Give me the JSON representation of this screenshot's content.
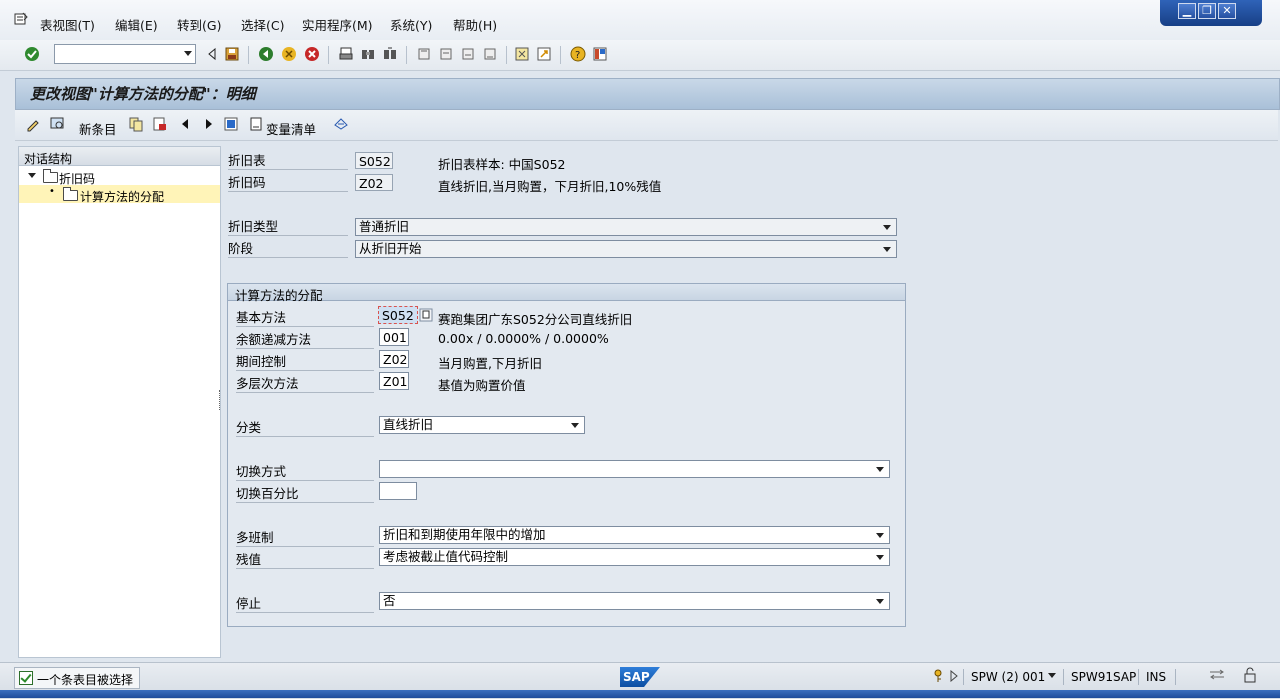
{
  "menu": {
    "items": [
      "表视图(T)",
      "编辑(E)",
      "转到(G)",
      "选择(C)",
      "实用程序(M)",
      "系统(Y)",
      "帮助(H)"
    ]
  },
  "window_controls": {
    "minimize": "▁",
    "restore": "❐",
    "close": "✕"
  },
  "screen_title": "更改视图\"计算方法的分配\"：明细",
  "app_toolbar": {
    "new_entries": "新条目",
    "change_list": "变量清单"
  },
  "tree": {
    "header": "对话结构",
    "items": [
      {
        "label": "折旧码"
      },
      {
        "label": "计算方法的分配"
      }
    ]
  },
  "header_fields": {
    "dep_chart": {
      "label": "折旧表",
      "value": "S052",
      "desc": "折旧表样本: 中国S052"
    },
    "dep_key": {
      "label": "折旧码",
      "value": "Z02",
      "desc": "直线折旧,当月购置，下月折旧,10%残值"
    },
    "dep_type": {
      "label": "折旧类型",
      "value": "普通折旧"
    },
    "phase": {
      "label": "阶段",
      "value": "从折旧开始"
    }
  },
  "group": {
    "title": "计算方法的分配",
    "base_method": {
      "label": "基本方法",
      "value": "S052",
      "desc": "赛跑集团广东S052分公司直线折旧"
    },
    "declining_method": {
      "label": "余额递减方法",
      "value": "001",
      "desc": "0.00x / 0.0000% / 0.0000%"
    },
    "period_control": {
      "label": "期间控制",
      "value": "Z02",
      "desc": "当月购置,下月折旧"
    },
    "multilevel": {
      "label": "多层次方法",
      "value": "Z01",
      "desc": "基值为购置价值"
    },
    "class": {
      "label": "分类",
      "value": "直线折旧"
    },
    "switch_method": {
      "label": "切换方式",
      "value": ""
    },
    "switch_pct": {
      "label": "切换百分比",
      "value": ""
    },
    "multi_shift": {
      "label": "多班制",
      "value": "折旧和到期使用年限中的增加"
    },
    "residual": {
      "label": "残值",
      "value": "考虑被截止值代码控制"
    },
    "stop": {
      "label": "停止",
      "value": "否"
    }
  },
  "status": {
    "message": "一个条表目被选择",
    "logo": "SAP",
    "system": "SPW (2) 001",
    "server": "SPW91SAP",
    "mode": "INS"
  },
  "colors": {
    "title_bg": "#b9cde1",
    "selected_tree": "#fff4b8",
    "focus_border": "#d9534f"
  }
}
